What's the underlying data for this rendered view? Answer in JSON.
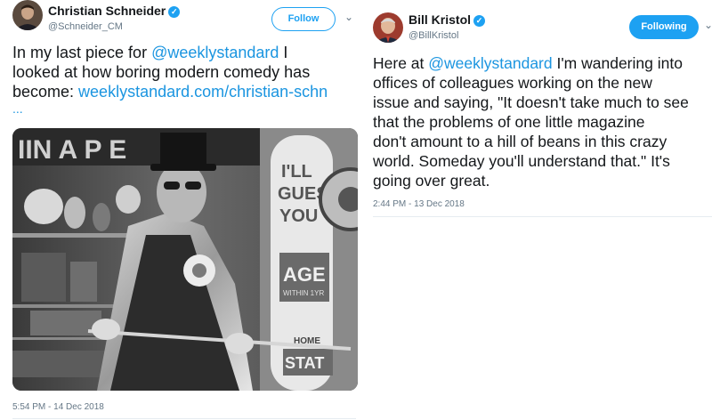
{
  "tweets": [
    {
      "name": "Christian Schneider",
      "handle": "@Schneider_CM",
      "follow_label": "Follow",
      "text_line1_a": "In my last piece for ",
      "text_line1_mention": "@weeklystandard",
      "text_line1_b": " I",
      "text_line2": "looked at how boring modern comedy has",
      "text_line3_a": "become: ",
      "text_line3_link": "weeklystandard.com/christian-schn",
      "text_line4": "...",
      "photo_sign_top": "IIN A P   E",
      "photo_sign_ill": "I'LL",
      "photo_sign_guess": "GUES",
      "photo_sign_you": "YOU",
      "photo_sign_age": "AGE",
      "photo_sign_within": "WITHIN 1YR",
      "photo_sign_home": "HOME",
      "photo_sign_stat": "STAT",
      "timestamp": "5:54 PM - 14 Dec 2018",
      "colors": {
        "accent": "#1da1f2"
      },
      "icons": [
        "verified-badge-icon",
        "chevron-down-icon"
      ]
    },
    {
      "name": "Bill Kristol",
      "handle": "@BillKristol",
      "follow_label": "Following",
      "text_line1_a": "Here at ",
      "text_line1_mention": "@weeklystandard",
      "text_line1_b": " I'm wandering into",
      "text_line2": "offices of colleagues working on the new",
      "text_line3": "issue and saying, \"It doesn't take much to see",
      "text_line4": "that the problems of one little magazine",
      "text_line5": "don't amount to a hill of beans in this crazy",
      "text_line6": "world. Someday you'll understand that.\" It's",
      "text_line7": "going over great.",
      "timestamp": "2:44 PM - 13 Dec 2018",
      "colors": {
        "accent": "#1da1f2"
      },
      "icons": [
        "verified-badge-icon",
        "chevron-down-icon"
      ]
    }
  ]
}
